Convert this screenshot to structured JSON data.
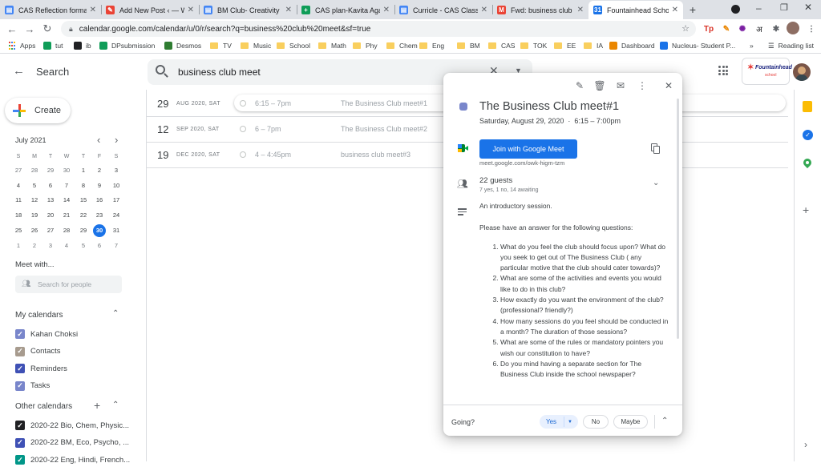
{
  "browser": {
    "tabs": [
      {
        "title": "CAS Reflection format",
        "favicon_color": "#4285f4",
        "favicon_glyph": "▤"
      },
      {
        "title": "Add New Post ‹ — Wo",
        "favicon_color": "#ea4335",
        "favicon_glyph": "✎"
      },
      {
        "title": "BM Club- Creativity",
        "favicon_color": "#4285f4",
        "favicon_glyph": "▤"
      },
      {
        "title": "CAS plan-Kavita Agar",
        "favicon_color": "#0f9d58",
        "favicon_glyph": "+"
      },
      {
        "title": "Curricle - CAS Class c",
        "favicon_color": "#4285f4",
        "favicon_glyph": "▤"
      },
      {
        "title": "Fwd: business club ev",
        "favicon_color": "#ea4335",
        "favicon_glyph": "M"
      },
      {
        "title": "Fountainhead School",
        "favicon_color": "#1a73e8",
        "favicon_glyph": "31"
      }
    ],
    "new_tab": "+",
    "url": "calendar.google.com/calendar/u/0/r/search?q=business%20club%20meet&sf=true",
    "bookmarks": [
      {
        "label": "Apps",
        "type": "apps"
      },
      {
        "label": "tut",
        "type": "icon",
        "color": "#0f9d58"
      },
      {
        "label": "ib",
        "type": "icon",
        "color": "#202124"
      },
      {
        "label": "DPsubmission",
        "type": "icon",
        "color": "#0f9d58"
      },
      {
        "label": "Desmos",
        "type": "icon",
        "color": "#2f7d32"
      },
      {
        "label": "TV",
        "type": "folder"
      },
      {
        "label": "Music",
        "type": "folder"
      },
      {
        "label": "School",
        "type": "folder"
      },
      {
        "label": "Math",
        "type": "folder"
      },
      {
        "label": "Phy",
        "type": "folder"
      },
      {
        "label": "Chem",
        "type": "folder"
      },
      {
        "label": "Eng",
        "type": "folder"
      },
      {
        "label": "BM",
        "type": "folder"
      },
      {
        "label": "CAS",
        "type": "folder"
      },
      {
        "label": "TOK",
        "type": "folder"
      },
      {
        "label": "EE",
        "type": "folder"
      },
      {
        "label": "IA",
        "type": "folder"
      },
      {
        "label": "Dashboard",
        "type": "icon",
        "color": "#ea8600"
      },
      {
        "label": "Nucleus- Student P...",
        "type": "icon",
        "color": "#1a73e8"
      }
    ],
    "more_bookmarks": "»",
    "reading_list": "Reading list"
  },
  "header": {
    "back_label": "←",
    "title": "Search",
    "query": "business club meet",
    "school_name": "Fountainhead",
    "school_sub": "school"
  },
  "sidebar": {
    "create_label": "Create",
    "month_label": "July 2021",
    "weekdays": [
      "S",
      "M",
      "T",
      "W",
      "T",
      "F",
      "S"
    ],
    "weeks": [
      [
        "27",
        "28",
        "29",
        "30",
        "1",
        "2",
        "3"
      ],
      [
        "4",
        "5",
        "6",
        "7",
        "8",
        "9",
        "10"
      ],
      [
        "11",
        "12",
        "13",
        "14",
        "15",
        "16",
        "17"
      ],
      [
        "18",
        "19",
        "20",
        "21",
        "22",
        "23",
        "24"
      ],
      [
        "25",
        "26",
        "27",
        "28",
        "29",
        "30",
        "31"
      ],
      [
        "1",
        "2",
        "3",
        "4",
        "5",
        "6",
        "7"
      ]
    ],
    "today": "30",
    "meet_with": "Meet with...",
    "search_people_placeholder": "Search for people",
    "my_calendars_title": "My calendars",
    "my_calendars": [
      {
        "name": "Kahan Choksi",
        "color": "#7986cb"
      },
      {
        "name": "Contacts",
        "color": "#a79b8e"
      },
      {
        "name": "Reminders",
        "color": "#3f51b5"
      },
      {
        "name": "Tasks",
        "color": "#7986cb"
      }
    ],
    "other_calendars_title": "Other calendars",
    "other_calendars": [
      {
        "name": "2020-22 Bio, Chem, Physic...",
        "color": "#202124"
      },
      {
        "name": "2020-22 BM, Eco, Psycho, ...",
        "color": "#3f51b5"
      },
      {
        "name": "2020-22 Eng, Hindi, French...",
        "color": "#009688"
      }
    ]
  },
  "results": [
    {
      "day": "29",
      "date": "AUG 2020, SAT",
      "time": "6:15 – 7pm",
      "name": "The Business Club meet#1"
    },
    {
      "day": "12",
      "date": "SEP 2020, SAT",
      "time": "6 – 7pm",
      "name": "The Business Club meet#2"
    },
    {
      "day": "19",
      "date": "DEC 2020, SAT",
      "time": "4 – 4:45pm",
      "name": "business club meet#3"
    }
  ],
  "popup": {
    "title": "The Business Club meet#1",
    "datetime": "Saturday, August 29, 2020  ·  6:15 – 7:00pm",
    "join_label": "Join with Google Meet",
    "meet_link": "meet.google.com/owk-higm-tzm",
    "guests": "22 guests",
    "guests_detail": "7 yes, 1 no, 14 awaiting",
    "desc_intro": "An introductory session.",
    "desc_prompt": "Please have an answer for the following questions:",
    "questions": [
      "What do you feel the club should focus upon? What do you seek to get out of The Business Club ( any particular motive that the club should cater towards)?",
      "What are some of the activities and events you would like to do in this club?",
      "How exactly do you want the environment of the club? (professional? friendly?)",
      "How many sessions do you feel should be conducted in a month? The duration of those sessions?",
      " What are some of the rules or mandatory pointers you wish our constitution to have?",
      "Do you mind having a separate section for The Business Club inside the school newspaper?"
    ],
    "going_label": "Going?",
    "yes_label": "Yes",
    "no_label": "No",
    "maybe_label": "Maybe",
    "event_color": "#7986cb"
  }
}
